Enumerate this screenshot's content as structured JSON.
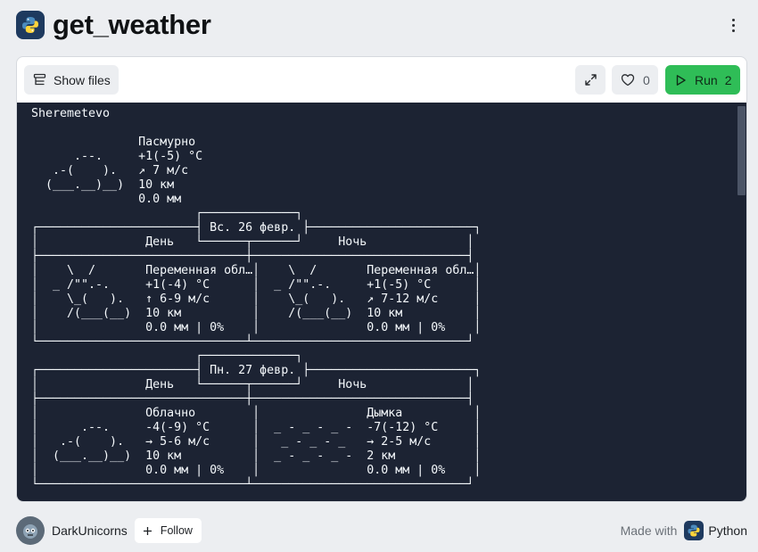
{
  "header": {
    "title": "get_weather"
  },
  "toolbar": {
    "show_files_label": "Show files",
    "like_count": "0",
    "run_label": "Run",
    "run_count": "2"
  },
  "console": {
    "lines": [
      "Sheremetevo",
      "",
      "               Пасмурно",
      "      .--.     +1(-5) °C",
      "   .-(    ).   ↗ 7 м/с",
      "  (___.__)__)  10 км",
      "               0.0 мм",
      "                       ┌─────────────┐",
      "┌──────────────────────┤ Вс. 26 февр. ├───────────────────────┐",
      "│               День   └──────┬──────┘     Ночь              │",
      "├─────────────────────────────┼──────────────────────────────┤",
      "│    \\  /       Переменная обл…│    \\  /       Переменная обл…│",
      "│  _ /\"\".-.     +1(-4) °C      │  _ /\"\".-.     +1(-5) °C      │",
      "│    \\_(   ).   ↑ 6-9 м/с      │    \\_(   ).   ↗ 7-12 м/с     │",
      "│    /(___(__)  10 км          │    /(___(__)  10 км          │",
      "│               0.0 мм | 0%    │               0.0 мм | 0%    │",
      "└─────────────────────────────┴──────────────────────────────┘",
      "                       ┌─────────────┐",
      "┌──────────────────────┤ Пн. 27 февр. ├───────────────────────┐",
      "│               День   └──────┬──────┘     Ночь              │",
      "├─────────────────────────────┼──────────────────────────────┤",
      "│               Облачно        │               Дымка          │",
      "│      .--.     -4(-9) °C      │  _ - _ - _ -  -7(-12) °C     │",
      "│   .-(    ).   → 5-6 м/с      │   _ - _ - _   → 2-5 м/с      │",
      "│  (___.__)__)  10 км          │  _ - _ - _ -  2 км           │",
      "│               0.0 мм | 0%    │               0.0 мм | 0%    │",
      "└─────────────────────────────┴──────────────────────────────┘"
    ]
  },
  "footer": {
    "username": "DarkUnicorns",
    "follow_label": "Follow",
    "made_with_label": "Made with",
    "language": "Python"
  }
}
